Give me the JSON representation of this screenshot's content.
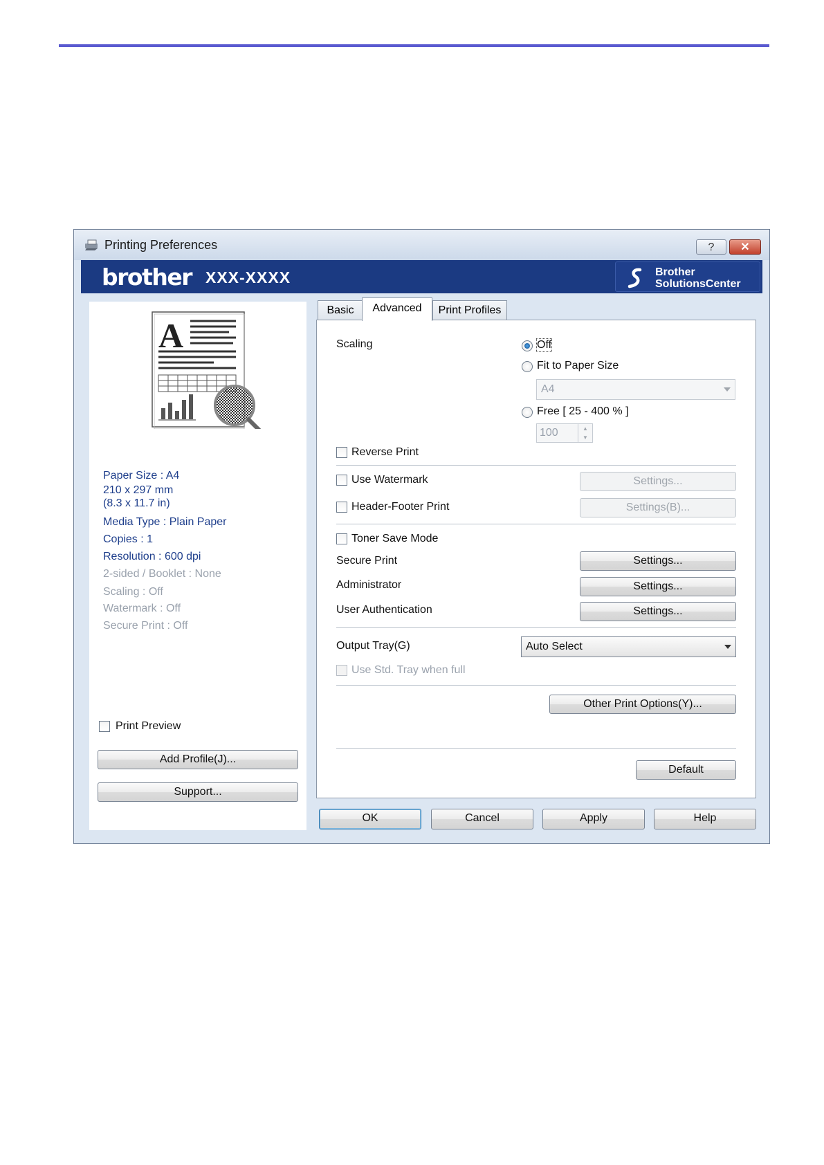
{
  "window": {
    "title": "Printing Preferences",
    "help_glyph": "?",
    "close_glyph": "✕"
  },
  "banner": {
    "brand": "brother",
    "model": "XXX-XXXX",
    "solutions_line1": "Brother",
    "solutions_line2": "SolutionsCenter"
  },
  "summary": {
    "paper_size": "Paper Size : A4",
    "dimensions_mm": "210 x 297 mm",
    "dimensions_in": "(8.3 x 11.7 in)",
    "media_type": "Media Type : Plain Paper",
    "copies": "Copies : 1",
    "resolution": "Resolution : 600 dpi",
    "two_sided": "2-sided / Booklet : None",
    "scaling": "Scaling : Off",
    "watermark": "Watermark : Off",
    "secure_print": "Secure Print : Off"
  },
  "left_controls": {
    "print_preview": "Print Preview",
    "add_profile": "Add Profile(J)...",
    "support": "Support..."
  },
  "tabs": [
    {
      "label": "Basic"
    },
    {
      "label": "Advanced"
    },
    {
      "label": "Print Profiles"
    }
  ],
  "advanced": {
    "scaling_label": "Scaling",
    "scaling_off": "Off",
    "fit_to_paper": "Fit to Paper Size",
    "fit_paper_value": "A4",
    "free": "Free [ 25 - 400 % ]",
    "free_value": "100",
    "reverse_print": "Reverse Print",
    "use_watermark": "Use Watermark",
    "watermark_settings": "Settings...",
    "header_footer": "Header-Footer Print",
    "header_footer_settings": "Settings(B)...",
    "toner_save": "Toner Save Mode",
    "secure_print": "Secure Print",
    "secure_print_settings": "Settings...",
    "administrator": "Administrator",
    "administrator_settings": "Settings...",
    "user_auth": "User Authentication",
    "user_auth_settings": "Settings...",
    "output_tray_label": "Output Tray(G)",
    "output_tray_value": "Auto Select",
    "use_std_tray": "Use Std. Tray when full",
    "other_print_options": "Other Print Options(Y)...",
    "default": "Default"
  },
  "footer": {
    "ok": "OK",
    "cancel": "Cancel",
    "apply": "Apply",
    "help": "Help"
  }
}
